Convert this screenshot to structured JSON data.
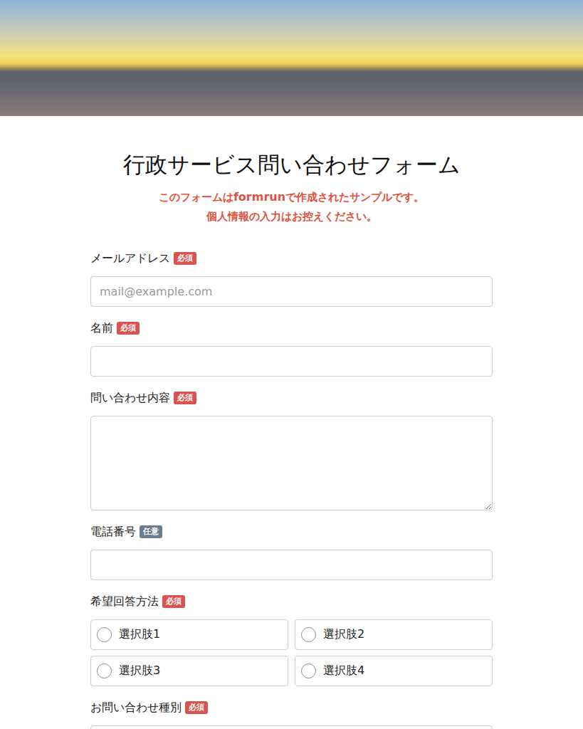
{
  "page": {
    "title": "行政サービス問い合わせフォーム",
    "notice": {
      "before": "このフォームは",
      "brand": "formrun",
      "after": "で作成されたサンプルです。",
      "second_line": "個人情報の入力はお控えください。"
    }
  },
  "fields": [
    {
      "kind": "text",
      "label": "メールアドレス",
      "badge": {
        "text": "必須",
        "required": true
      },
      "placeholder": "mail@example.com"
    },
    {
      "kind": "text",
      "label": "名前",
      "badge": {
        "text": "必須",
        "required": true
      },
      "placeholder": ""
    },
    {
      "kind": "textarea",
      "label": "問い合わせ内容",
      "badge": {
        "text": "必須",
        "required": true
      },
      "placeholder": ""
    },
    {
      "kind": "text",
      "label": "電話番号",
      "badge": {
        "text": "任意",
        "required": false
      },
      "placeholder": ""
    },
    {
      "kind": "radio",
      "label": "希望回答方法",
      "badge": {
        "text": "必須",
        "required": true
      },
      "options": [
        {
          "label": "選択肢1",
          "selected": false
        },
        {
          "label": "選択肢2",
          "selected": false
        },
        {
          "label": "選択肢3",
          "selected": false
        },
        {
          "label": "選択肢4",
          "selected": false
        }
      ]
    },
    {
      "kind": "select",
      "label": "お問い合わせ種別",
      "badge": {
        "text": "必須",
        "required": true
      }
    }
  ]
}
